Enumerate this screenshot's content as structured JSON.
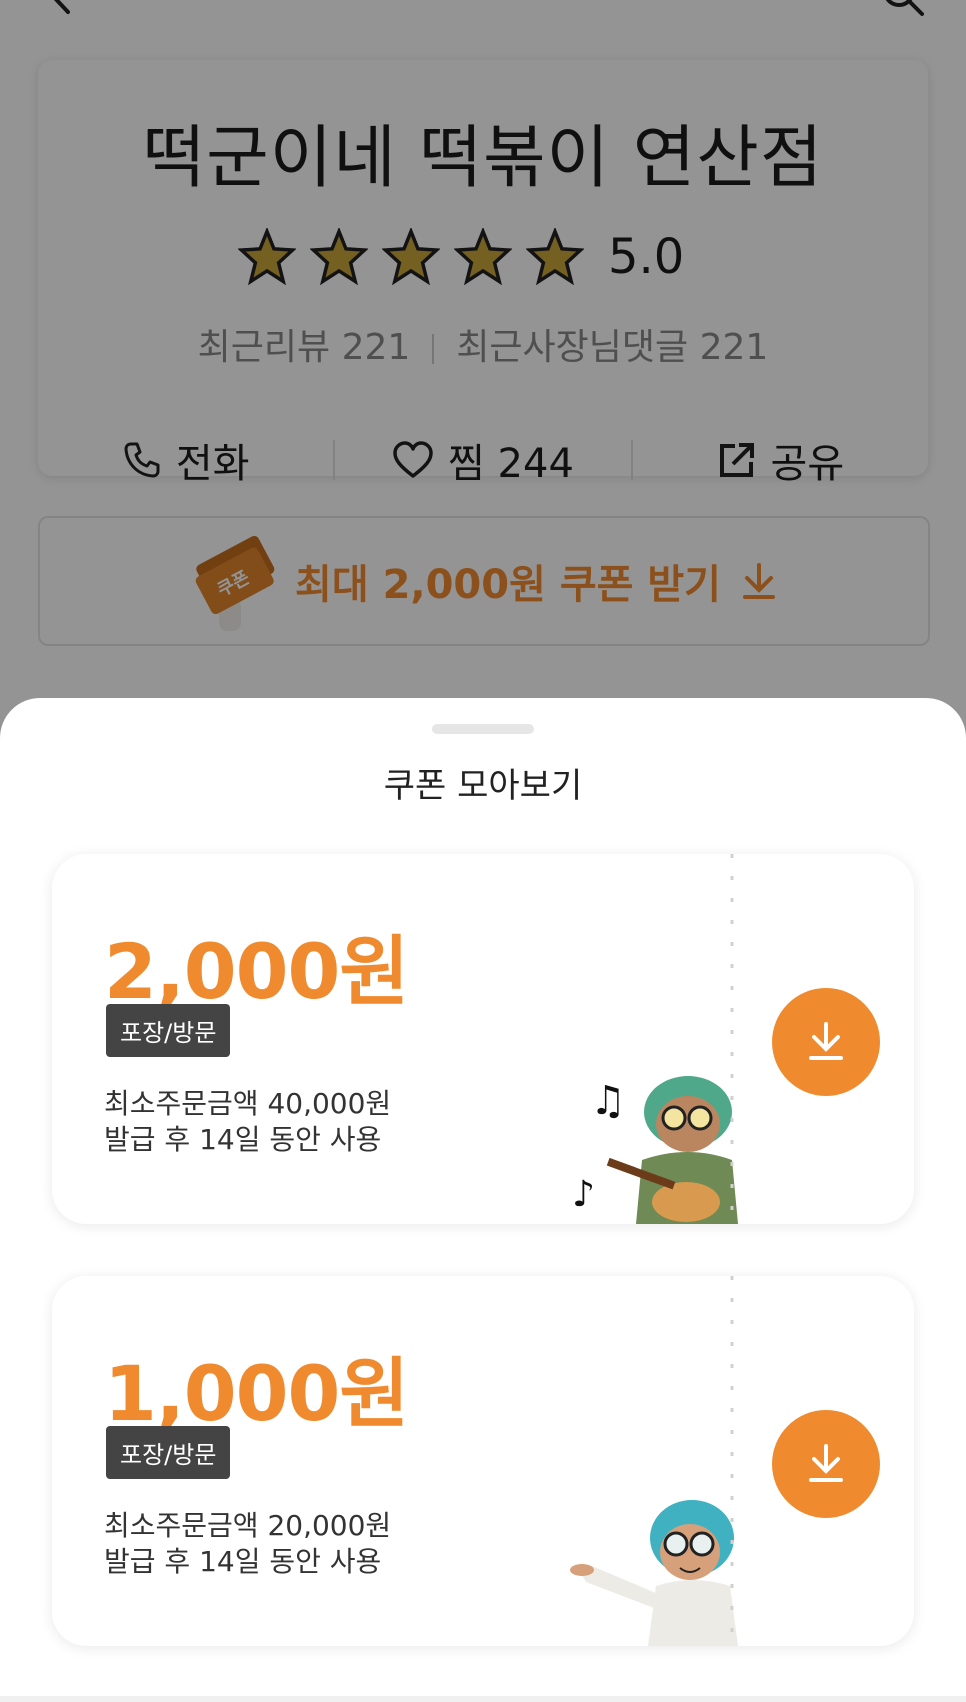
{
  "store": {
    "name": "떡군이네 떡볶이 연산점",
    "rating": "5.0",
    "stars": 5,
    "recent_reviews": "최근리뷰 221",
    "owner_replies": "최근사장님댓글 221",
    "actions": {
      "call_label": "전화",
      "wish_label": "찜 244",
      "share_label": "공유"
    },
    "coupon_banner": "최대 2,000원 쿠폰 받기",
    "banner_art_text": "쿠폰"
  },
  "sheet": {
    "title": "쿠폰 모아보기",
    "coupons": [
      {
        "amount": "2,000원",
        "tag": "포장/방문",
        "min_order": "최소주문금액 40,000원",
        "validity": "발급 후 14일 동안 사용"
      },
      {
        "amount": "1,000원",
        "tag": "포장/방문",
        "min_order": "최소주문금액 20,000원",
        "validity": "발급 후 14일 동안 사용"
      }
    ]
  },
  "colors": {
    "accent": "#f08a2f",
    "tag_bg": "#444444",
    "star": "#c9a53a"
  },
  "icons": [
    "back-icon",
    "search-icon",
    "star-icon",
    "phone-icon",
    "heart-icon",
    "share-icon",
    "download-arrow-icon",
    "download-icon"
  ]
}
